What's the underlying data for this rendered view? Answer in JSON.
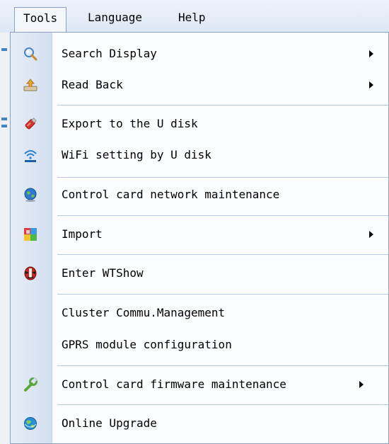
{
  "menubar": {
    "items": [
      {
        "label": "Tools",
        "open": true
      },
      {
        "label": "Language"
      },
      {
        "label": "Help"
      }
    ]
  },
  "tools_menu": {
    "items": [
      {
        "label": "Search Display",
        "icon": "search-magnifier-icon",
        "submenu": true
      },
      {
        "label": "Read Back",
        "icon": "read-back-icon",
        "submenu": true
      },
      {
        "label": "Export to the U disk",
        "icon": "usb-disk-icon",
        "submenu": false
      },
      {
        "label": "WiFi setting by U disk",
        "icon": "wifi-icon",
        "submenu": false
      },
      {
        "label": "Control card network maintenance",
        "icon": "globe-icon",
        "submenu": false
      },
      {
        "label": "Import",
        "icon": "import-icon",
        "submenu": true
      },
      {
        "label": "Enter WTShow",
        "icon": "mask-icon",
        "submenu": false
      },
      {
        "label": "Cluster Commu.Management",
        "icon": "",
        "submenu": false
      },
      {
        "label": "GPRS module configuration",
        "icon": "",
        "submenu": false
      },
      {
        "label": "Control card firmware maintenance",
        "icon": "wrench-icon",
        "submenu": true
      },
      {
        "label": "Online Upgrade",
        "icon": "upgrade-globe-icon",
        "submenu": false
      }
    ]
  },
  "colors": {
    "menu_border": "#8aa3c5",
    "rail": "#d3dff0",
    "separator": "#b9c8de"
  }
}
